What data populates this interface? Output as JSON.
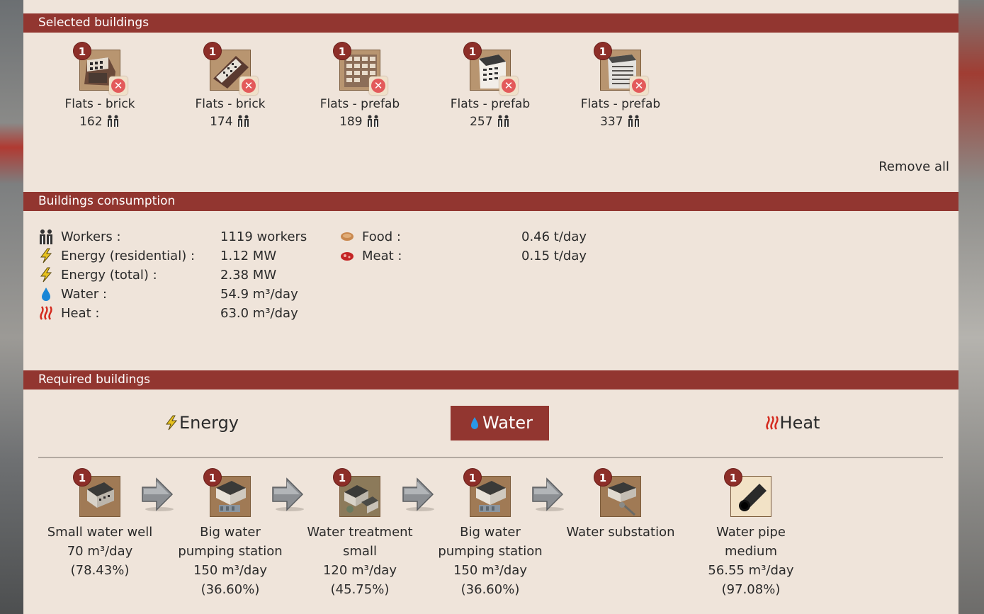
{
  "selected": {
    "title": "Selected buildings",
    "remove_all": "Remove all",
    "buildings": [
      {
        "count": "1",
        "name": "Flats - brick",
        "workers": "162"
      },
      {
        "count": "1",
        "name": "Flats - brick",
        "workers": "174"
      },
      {
        "count": "1",
        "name": "Flats - prefab",
        "workers": "189"
      },
      {
        "count": "1",
        "name": "Flats - prefab",
        "workers": "257"
      },
      {
        "count": "1",
        "name": "Flats - prefab",
        "workers": "337"
      }
    ]
  },
  "consumption": {
    "title": "Buildings consumption",
    "left": [
      {
        "icon": "workers-icon",
        "label": "Workers :",
        "value": "1119 workers"
      },
      {
        "icon": "energy-icon",
        "label": "Energy (residential) :",
        "value": "1.12 MW"
      },
      {
        "icon": "energy-icon",
        "label": "Energy (total) :",
        "value": "2.38 MW"
      },
      {
        "icon": "water-drop-icon",
        "label": "Water :",
        "value": "54.9 m³/day"
      },
      {
        "icon": "heat-icon",
        "label": "Heat :",
        "value": "63.0 m³/day"
      }
    ],
    "right": [
      {
        "icon": "food-icon",
        "label": "Food :",
        "value": "0.46 t/day"
      },
      {
        "icon": "meat-icon",
        "label": "Meat :",
        "value": "0.15 t/day"
      }
    ]
  },
  "required": {
    "title": "Required buildings",
    "tabs": [
      {
        "label": "Energy",
        "icon": "energy-icon",
        "active": false
      },
      {
        "label": "Water",
        "icon": "water-drop-icon",
        "active": true
      },
      {
        "label": "Heat",
        "icon": "heat-icon",
        "active": false
      }
    ],
    "chain": [
      {
        "count": "1",
        "lines": [
          "Small water well",
          "70 m³/day",
          "(78.43%)"
        ]
      },
      {
        "count": "1",
        "lines": [
          "Big water",
          "pumping station",
          "150 m³/day",
          "(36.60%)"
        ]
      },
      {
        "count": "1",
        "lines": [
          "Water treatment",
          "small",
          "120 m³/day",
          "(45.75%)"
        ]
      },
      {
        "count": "1",
        "lines": [
          "Big water",
          "pumping station",
          "150 m³/day",
          "(36.60%)"
        ]
      },
      {
        "count": "1",
        "lines": [
          "Water substation"
        ]
      },
      {
        "count": "1",
        "lines": [
          "Water pipe",
          "medium",
          "56.55 m³/day",
          "(97.08%)"
        ]
      }
    ]
  },
  "colors": {
    "panel_bg": "#efe4da",
    "header_bg": "#923630",
    "badge_bg": "#8d2e28",
    "energy": "#e8c21e",
    "water": "#1a86d6",
    "heat": "#d42a1e"
  }
}
